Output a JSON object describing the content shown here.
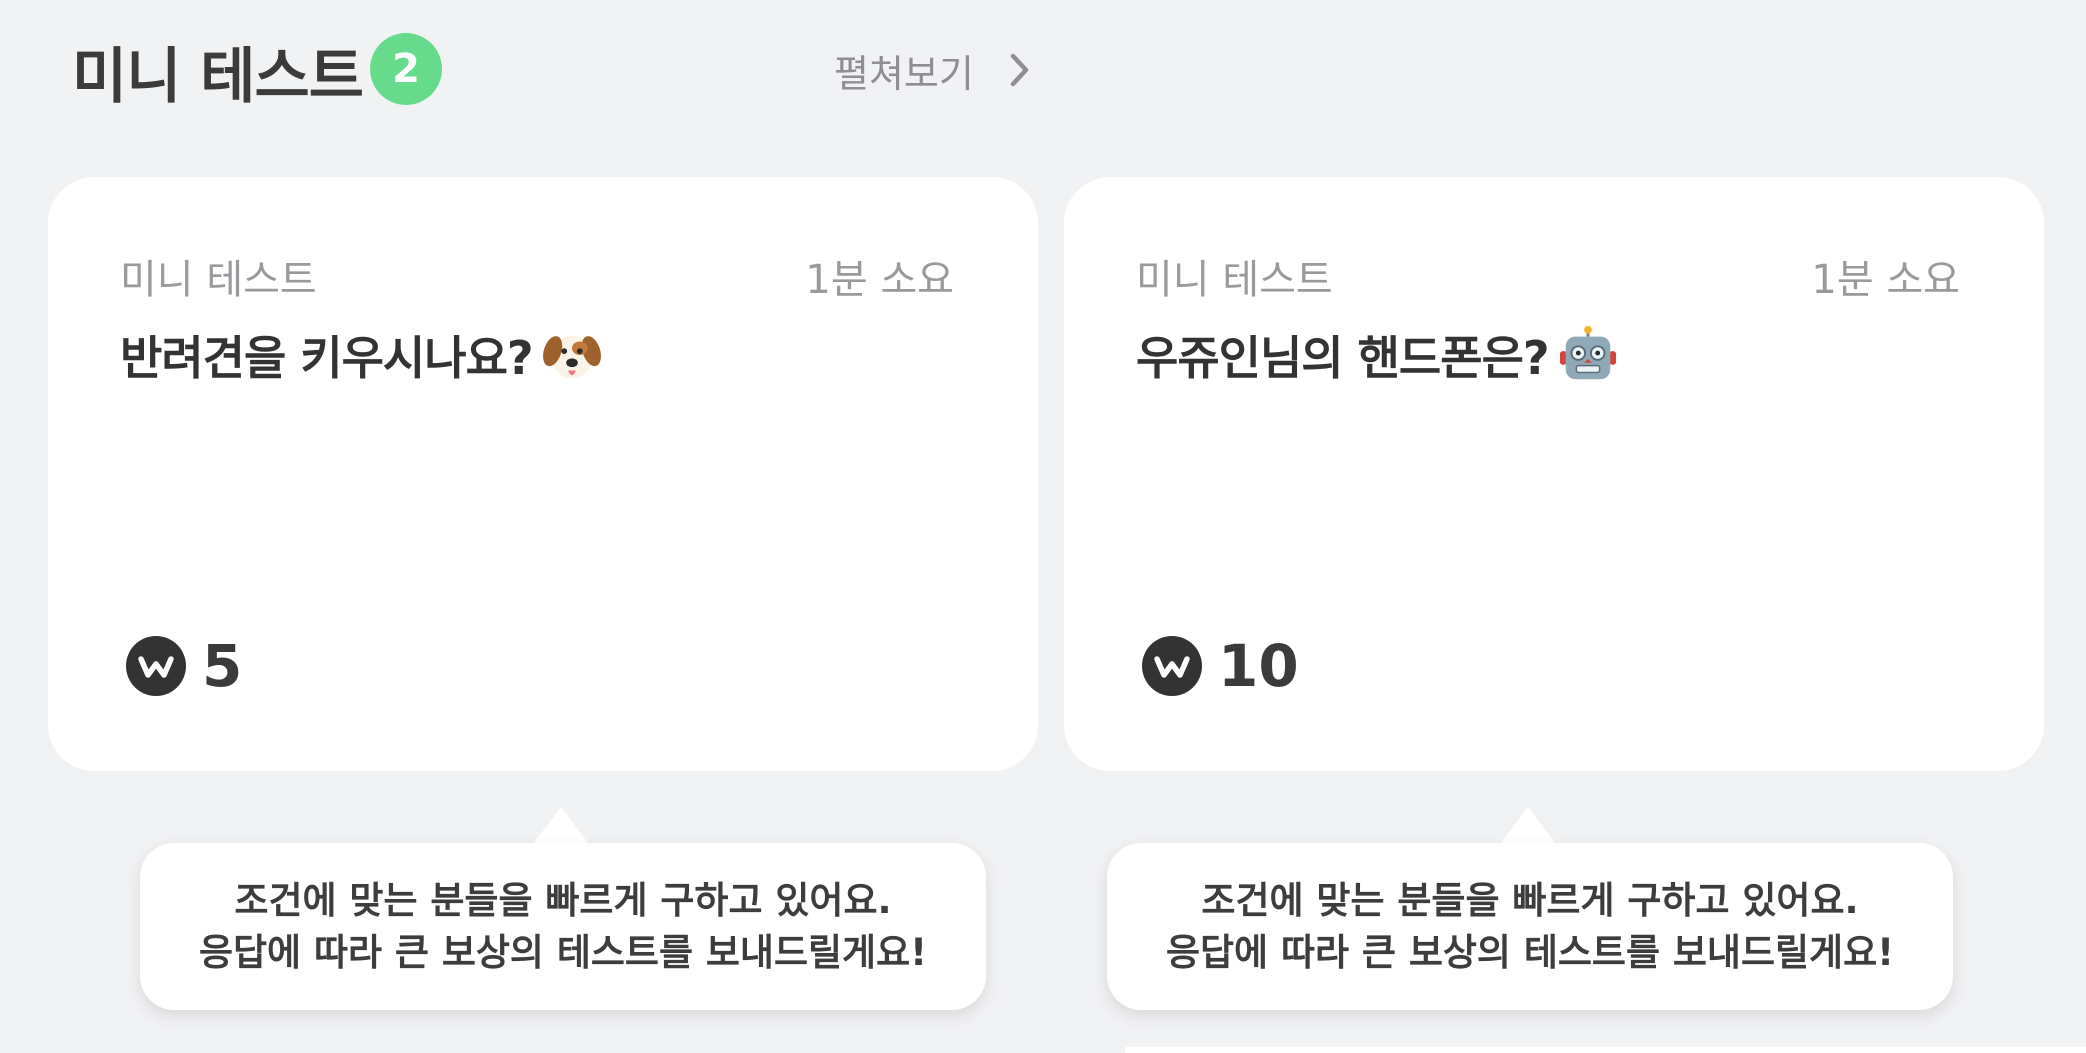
{
  "header": {
    "title": "미니 테스트",
    "count": "2",
    "expand_label": "펼쳐보기",
    "expand_icon": "chevron-right-icon"
  },
  "cards": [
    {
      "category": "미니 테스트",
      "duration": "1분 소요",
      "question": "반려견을 키우시나요?",
      "emoji_icon": "dog-face-icon",
      "reward_icon": "w-coin-icon",
      "reward": "5"
    },
    {
      "category": "미니 테스트",
      "duration": "1분 소요",
      "question": "우쥬인님의 핸드폰은?",
      "emoji_icon": "robot-face-icon",
      "reward_icon": "w-coin-icon",
      "reward": "10"
    }
  ],
  "tooltips": [
    {
      "line1": "조건에 맞는 분들을 빠르게 구하고 있어요.",
      "line2": "응답에 따라 큰 보상의 테스트를 보내드릴게요!"
    },
    {
      "line1": "조건에 맞는 분들을 빠르게 구하고 있어요.",
      "line2": "응답에 따라 큰 보상의 테스트를 보내드릴게요!"
    }
  ],
  "colors": {
    "background": "#f1f2f4",
    "badge": "#66db8c",
    "card": "#ffffff",
    "title_text": "#3b3b3b",
    "muted_text": "#9a9a9e"
  }
}
